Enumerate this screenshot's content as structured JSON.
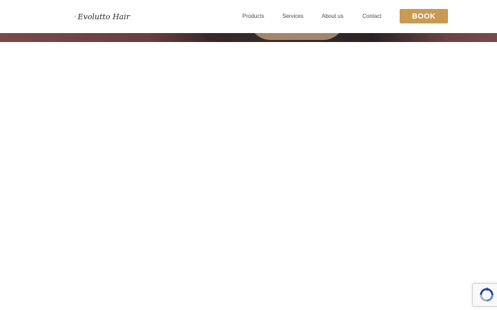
{
  "header": {
    "logo": {
      "text": "Evolutto Hair",
      "icon": "hair-logo-icon"
    },
    "nav": [
      {
        "label": "Products"
      },
      {
        "label": "Services"
      },
      {
        "label": "About us"
      },
      {
        "label": "Contact"
      }
    ],
    "book_label": "BOOK"
  },
  "colors": {
    "accent": "#c99a52",
    "hero_tone": "#6a3d3f"
  },
  "recaptcha": {
    "icon": "recaptcha-icon"
  }
}
